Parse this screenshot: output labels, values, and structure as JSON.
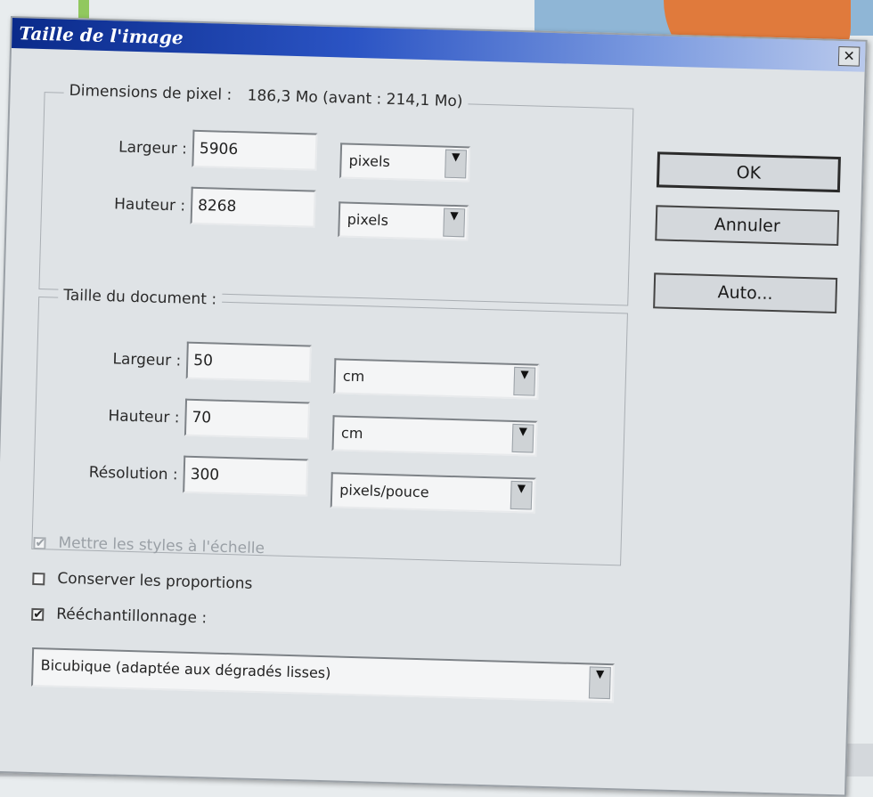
{
  "window": {
    "title": "Taille de l'image",
    "close_glyph": "✕"
  },
  "pixel_dimensions": {
    "legend": "Dimensions de pixel :",
    "summary": "186,3 Mo (avant : 214,1 Mo)",
    "width": {
      "label": "Largeur :",
      "value": "5906",
      "unit": "pixels"
    },
    "height": {
      "label": "Hauteur :",
      "value": "8268",
      "unit": "pixels"
    }
  },
  "document_size": {
    "legend": "Taille du document :",
    "width": {
      "label": "Largeur :",
      "value": "50",
      "unit": "cm"
    },
    "height": {
      "label": "Hauteur :",
      "value": "70",
      "unit": "cm"
    },
    "resolution": {
      "label": "Résolution :",
      "value": "300",
      "unit": "pixels/pouce"
    }
  },
  "options": {
    "scale_styles": {
      "label": "Mettre les styles à l'échelle",
      "checked": true,
      "enabled": false
    },
    "constrain": {
      "label": "Conserver les proportions",
      "checked": false
    },
    "resample": {
      "label": "Rééchantillonnage :",
      "checked": true
    },
    "method": "Bicubique (adaptée aux dégradés lisses)"
  },
  "buttons": {
    "ok": "OK",
    "cancel": "Annuler",
    "auto": "Auto..."
  },
  "icons": {
    "dropdown": "▼",
    "check": "✔"
  }
}
